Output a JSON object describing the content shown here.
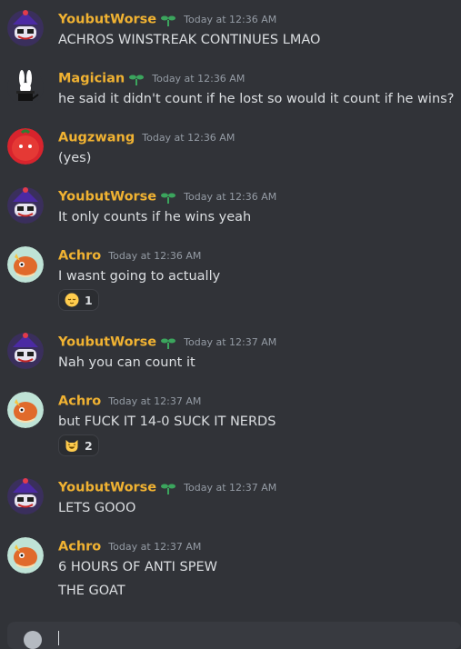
{
  "messages": [
    {
      "user": "YoubutWorse",
      "time": "Today at 12:36 AM",
      "text": "ACHROS WINSTREAK CONTINUES LMAO"
    },
    {
      "user": "Magician",
      "time": "Today at 12:36 AM",
      "text": "he said it didn't count if he lost so would it count if he wins?"
    },
    {
      "user": "Augzwang",
      "time": "Today at 12:36 AM",
      "text": "(yes)"
    },
    {
      "user": "YoubutWorse",
      "time": "Today at 12:36 AM",
      "text": "It only counts if he wins yeah"
    },
    {
      "user": "Achro",
      "time": "Today at 12:36 AM",
      "text": "I wasnt going to actually",
      "reaction": {
        "emoji": "relieved-face",
        "count": "1"
      }
    },
    {
      "user": "YoubutWorse",
      "time": "Today at 12:37 AM",
      "text": "Nah you can count it"
    },
    {
      "user": "Achro",
      "time": "Today at 12:37 AM",
      "text": "but FUCK IT 14-0 SUCK IT NERDS",
      "reaction": {
        "emoji": "grinning-cat-face",
        "count": "2"
      }
    },
    {
      "user": "YoubutWorse",
      "time": "Today at 12:37 AM",
      "text": "LETS GOOO"
    },
    {
      "user": "Achro",
      "time": "Today at 12:37 AM",
      "text": "6 HOURS OF ANTI SPEW",
      "text2": "THE GOAT"
    }
  ],
  "colors": {
    "username": "#f0b232",
    "background": "#313338",
    "timestamp": "#949ba4",
    "sprout": "#3ba55d"
  },
  "icons": {
    "badge": "sprout-icon",
    "composer": "plus-circle-icon"
  }
}
